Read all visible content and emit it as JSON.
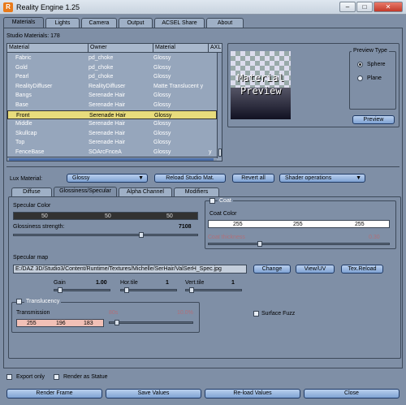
{
  "window": {
    "title": "Reality Engine 1.25",
    "icon_letter": "R",
    "minimize": "–",
    "maximize": "□",
    "close": "✕"
  },
  "tabs": [
    "Materials",
    "Lights",
    "Camera",
    "Output",
    "ACSEL Share",
    "About"
  ],
  "studio_materials_label": "Studio Materials: 178",
  "table": {
    "headers": [
      "Material",
      "Owner",
      "Material",
      "AXL"
    ],
    "rows": [
      {
        "name": "Fabric",
        "owner": "pd_choke",
        "type": "Glossy"
      },
      {
        "name": "Gold",
        "owner": "pd_choke",
        "type": "Glossy"
      },
      {
        "name": "Pearl",
        "owner": "pd_choke",
        "type": "Glossy"
      },
      {
        "name": "RealityDiffuser",
        "owner": "RealityDiffuser",
        "type": "Matte Translucent y"
      },
      {
        "name": "Bangs",
        "owner": "Serenade Hair",
        "type": "Glossy"
      },
      {
        "name": "Base",
        "owner": "Serenade Hair",
        "type": "Glossy"
      },
      {
        "name": "Front",
        "owner": "Serenade Hair",
        "type": "Glossy"
      },
      {
        "name": "Middle",
        "owner": "Serenade Hair",
        "type": "Glossy"
      },
      {
        "name": "Skullcap",
        "owner": "Serenade Hair",
        "type": "Glossy"
      },
      {
        "name": "Top",
        "owner": "Serenade Hair",
        "type": "Glossy"
      },
      {
        "name": "FenceBase",
        "owner": "SOArcFnceA",
        "type": "Glossy"
      }
    ],
    "selected_row": 6,
    "last_row_axl": "y"
  },
  "preview": {
    "image_text_line1": "Material",
    "image_text_line2": "Preview",
    "type_title": "Preview Type",
    "options": [
      "Sphere",
      "Plane"
    ],
    "selected_option": "Sphere",
    "button": "Preview"
  },
  "lux": {
    "label": "Lux Material:",
    "value": "Glossy",
    "reload_button": "Reload Studio Mat.",
    "revert_button": "Revert all",
    "shader_ops": "Shader operations"
  },
  "subtabs": [
    "Diffuse",
    "Glossiness/Specular",
    "Alpha Channel",
    "Modifiers"
  ],
  "specular": {
    "color_label": "Specular Color",
    "rgb": [
      "50",
      "50",
      "50"
    ],
    "glossiness_label": "Glossiness strength:",
    "glossiness_value": "7108"
  },
  "coat": {
    "title": "Coat",
    "color_label": "Coat Color",
    "rgb": [
      "255",
      "255",
      "255"
    ],
    "thickness_label": "Coat thickness",
    "thickness_value": "0.30"
  },
  "specular_map": {
    "label": "Specular map",
    "path": "E:/DAZ 3D/Studio3/Content/Runtime/Textures/Michelle/SerHair/ValSerH_Spec.jpg",
    "change": "Change",
    "view_uv": "View/UV",
    "tex_reload": "Tex.Reload",
    "gain_label": "Gain",
    "gain_value": "1.00",
    "hor_label": "Hor.tile",
    "hor_value": "1",
    "vert_label": "Vert.tile",
    "vert_value": "1"
  },
  "translucency": {
    "title": "Translucency",
    "transmission_label": "Transmission",
    "rgb": [
      "255",
      "196",
      "183"
    ],
    "extra1": "80s",
    "extra2": "10.0%",
    "surface_fuzz": "Surface Fuzz"
  },
  "bottom": {
    "export_only": "Export only",
    "render_as_statue": "Render as Statue",
    "buttons": [
      "Render Frame",
      "Save Values",
      "Re-load Values",
      "Close"
    ]
  },
  "colors": {
    "background": "#7f8fa6",
    "selected_row": "#e8dc7c",
    "button": "#8fb0dc"
  }
}
